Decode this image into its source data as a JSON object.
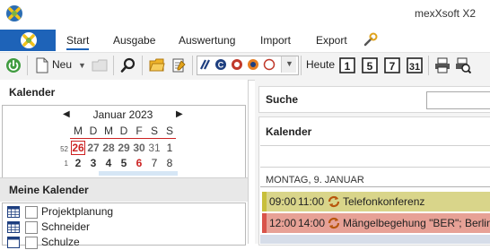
{
  "app": {
    "title": "mexXsoft X2"
  },
  "ribbon": {
    "tabs": [
      {
        "label": "Start",
        "active": true
      },
      {
        "label": "Ausgabe"
      },
      {
        "label": "Auswertung"
      },
      {
        "label": "Import"
      },
      {
        "label": "Export"
      }
    ]
  },
  "toolbar": {
    "new_label": "Neu",
    "today_label": "Heute",
    "view_day": "1",
    "view_workweek": "5",
    "view_week": "7",
    "view_month": "31"
  },
  "left": {
    "calendar_title": "Kalender",
    "month_label": "Januar 2023",
    "weekdays": [
      "M",
      "D",
      "M",
      "D",
      "F",
      "S",
      "S"
    ],
    "weeks": [
      {
        "kw": "52",
        "days": [
          "26",
          "27",
          "28",
          "29",
          "30",
          "31",
          "1"
        ]
      },
      {
        "kw": "1",
        "days": [
          "2",
          "3",
          "4",
          "5",
          "6",
          "7",
          "8"
        ]
      }
    ],
    "my_calendars_title": "Meine Kalender",
    "calendars": [
      "Projektplanung",
      "Schneider",
      "Schulze"
    ]
  },
  "right": {
    "search_label": "Suche",
    "calendar_label": "Kalender",
    "day_header": "MONTAG, 9. JANUAR",
    "events": [
      {
        "start": "09:00",
        "end": "11:00",
        "title": "Telefonkonferenz",
        "color": "#d9d58a",
        "bar": "#c8bf3a"
      },
      {
        "start": "12:00",
        "end": "14:00",
        "title": "Mängelbegehung \"BER\"; Berlin",
        "color": "#e7a196",
        "bar": "#d9534a"
      }
    ]
  },
  "colors": {
    "accent": "#1e63b8",
    "weekend_red": "#cc2222"
  }
}
